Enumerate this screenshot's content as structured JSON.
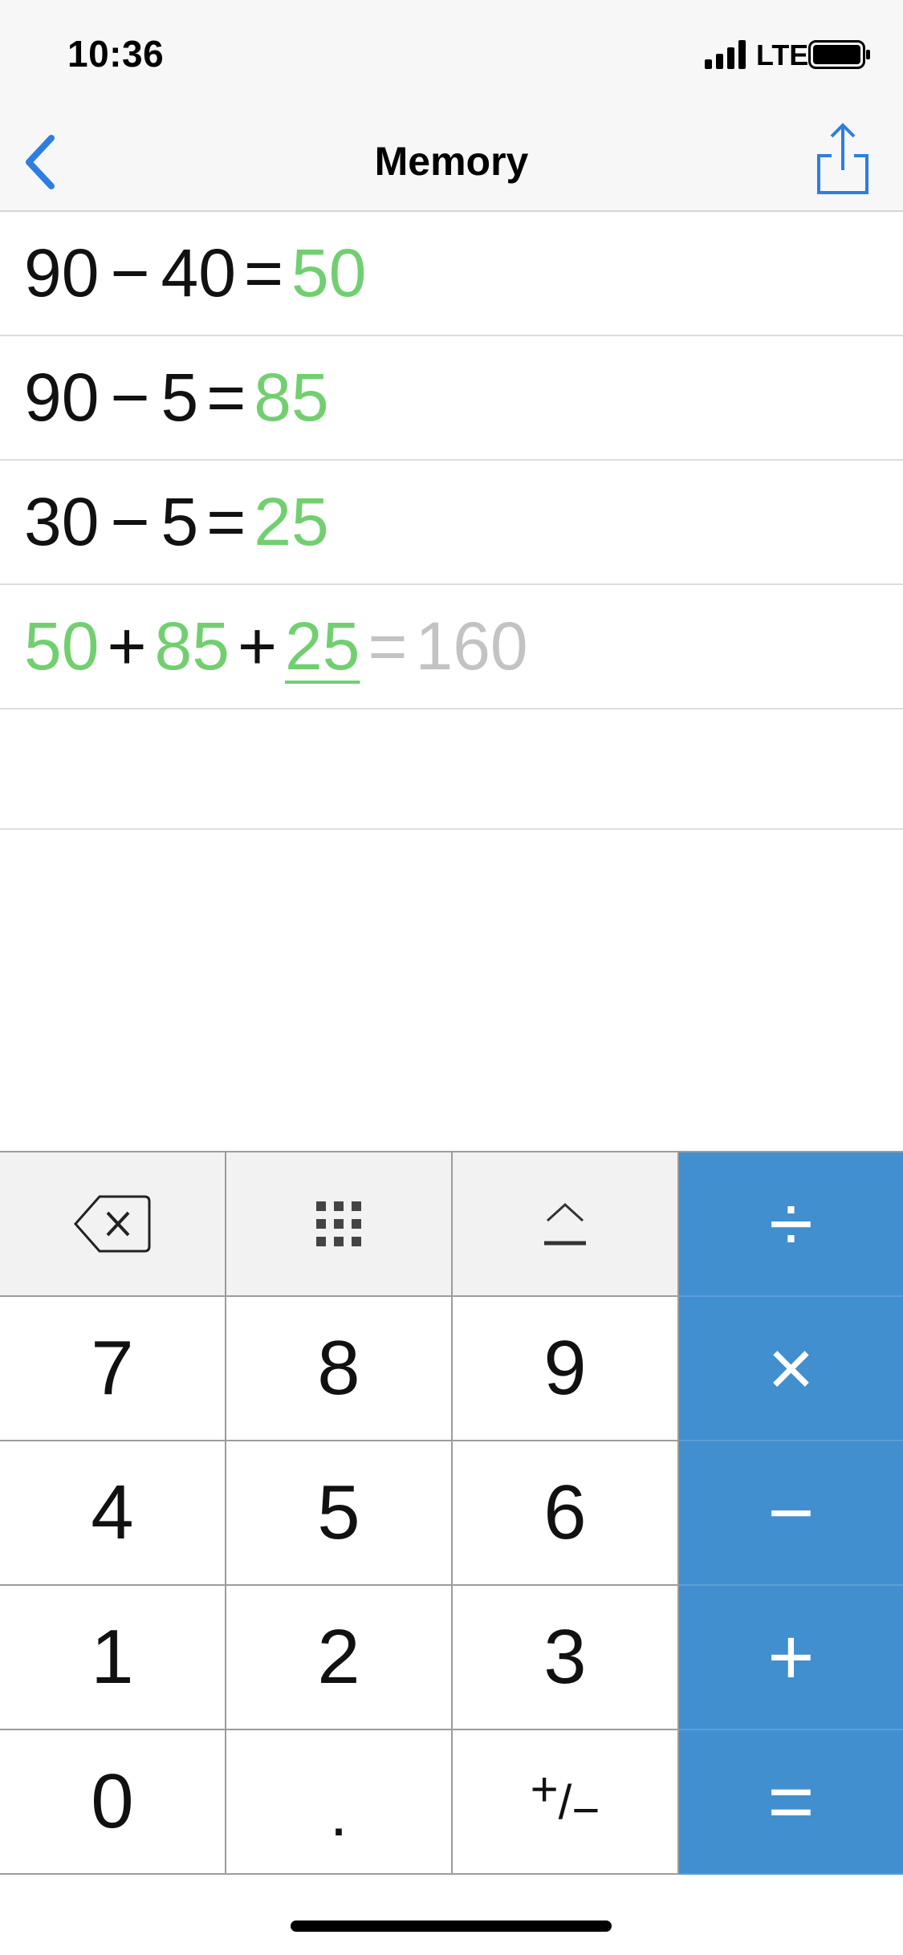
{
  "status_bar": {
    "time": "10:36",
    "network": "LTE",
    "signal_icon": "cellular-signal-icon",
    "battery_icon": "battery-icon"
  },
  "nav": {
    "title": "Memory",
    "back_icon": "chevron-left-icon",
    "share_icon": "share-icon",
    "accent_color": "#2f7de0"
  },
  "memory": {
    "rows": [
      {
        "a": "90",
        "op": "−",
        "b": "40",
        "eq": "=",
        "result": "50"
      },
      {
        "a": "90",
        "op": "−",
        "b": "5",
        "eq": "=",
        "result": "85"
      },
      {
        "a": "30",
        "op": "−",
        "b": "5",
        "eq": "=",
        "result": "25"
      }
    ],
    "current": {
      "t1": "50",
      "op1": "+",
      "t2": "85",
      "op2": "+",
      "t3": "25",
      "eq": "=",
      "result": "160"
    }
  },
  "keypad": {
    "func_keys": [
      "backspace-icon",
      "grid-icon",
      "eject-icon"
    ],
    "divide": "÷",
    "multiply": "×",
    "minus": "−",
    "plus": "+",
    "equals": "=",
    "digits": {
      "d7": "7",
      "d8": "8",
      "d9": "9",
      "d4": "4",
      "d5": "5",
      "d6": "6",
      "d1": "1",
      "d2": "2",
      "d3": "3",
      "d0": "0"
    },
    "dot": ".",
    "sign_plus": "+",
    "sign_sep": "/",
    "sign_minus": "−",
    "op_color": "#418fce"
  },
  "colors": {
    "result_green": "#72cf70",
    "pending_gray": "#c3c3c3"
  }
}
